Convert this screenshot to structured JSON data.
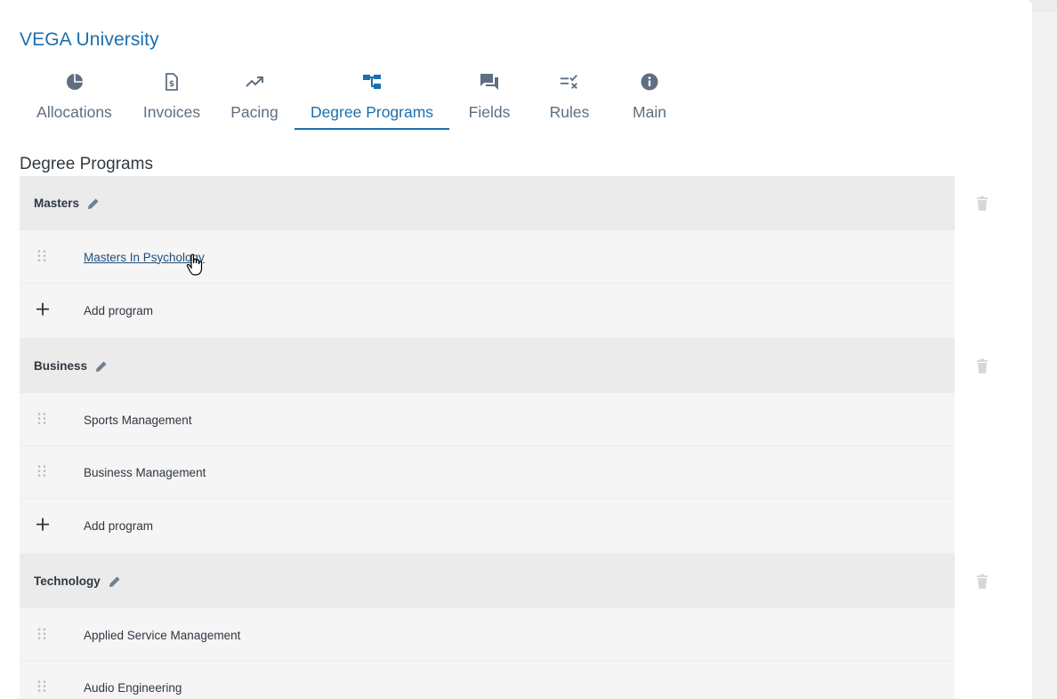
{
  "app": {
    "title": "VEGA University"
  },
  "tabs": [
    {
      "label": "Allocations",
      "icon": "pie-chart-icon"
    },
    {
      "label": "Invoices",
      "icon": "invoice-dollar-icon"
    },
    {
      "label": "Pacing",
      "icon": "trending-up-icon"
    },
    {
      "label": "Degree Programs",
      "icon": "hierarchy-icon",
      "active": true
    },
    {
      "label": "Fields",
      "icon": "chat-bubbles-icon"
    },
    {
      "label": "Rules",
      "icon": "rule-check-icon"
    },
    {
      "label": "Main",
      "icon": "info-circle-icon"
    }
  ],
  "section": {
    "title": "Degree Programs"
  },
  "groups": [
    {
      "name": "Masters",
      "programs": [
        "Masters In Psychology"
      ],
      "add_label": "Add program"
    },
    {
      "name": "Business",
      "programs": [
        "Sports Management",
        "Business Management"
      ],
      "add_label": "Add program"
    },
    {
      "name": "Technology",
      "programs": [
        "Applied Service Management",
        "Audio Engineering"
      ]
    }
  ],
  "colors": {
    "accent": "#1c6fae",
    "tab_text": "#5d6f80",
    "group_bg": "#ebebeb",
    "row_bg": "#f5f5f5"
  }
}
